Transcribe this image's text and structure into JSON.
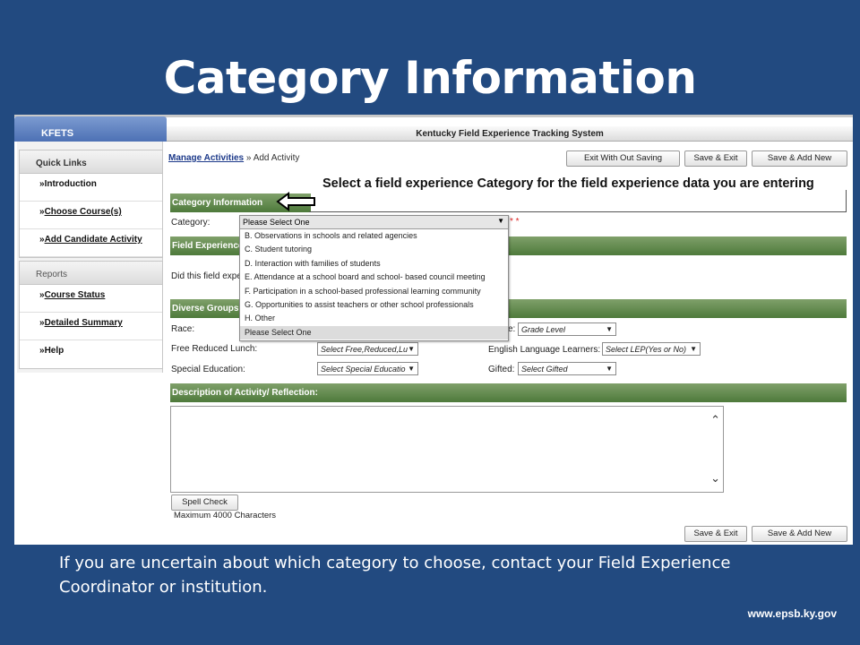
{
  "slide": {
    "title": "Category Information",
    "caption": "If you are uncertain about which category to choose, contact your Field Experience Coordinator or institution.",
    "url": "www.epsb.ky.gov"
  },
  "app": {
    "tab": "KFETS",
    "system_title": "Kentucky Field Experience Tracking System"
  },
  "sidebar": {
    "quick_links_title": "Quick Links",
    "reports_title": "Reports",
    "quick_links": [
      {
        "prefix": "»",
        "label": "Introduction"
      },
      {
        "prefix": "»",
        "label": "Choose Course(s)"
      },
      {
        "prefix": "»",
        "label": "Add Candidate Activity"
      }
    ],
    "reports": [
      {
        "prefix": "»",
        "label": "Course Status"
      },
      {
        "prefix": "»",
        "label": "Detailed Summary"
      },
      {
        "prefix": "»",
        "label": "Help"
      }
    ]
  },
  "breadcrumb": {
    "link": "Manage Activities",
    "separator": " » ",
    "current": "Add Activity"
  },
  "toolbar": {
    "exit_without_saving": "Exit With Out Saving",
    "save_exit": "Save & Exit",
    "save_add_new": "Save & Add New"
  },
  "headline": "Select a field experience Category for the field experience data you are entering",
  "sections": {
    "category": "Category Information",
    "field_experience": "Field Experience",
    "diverse_groups": "Diverse Groups",
    "description": "Description of Activity/ Reflection:"
  },
  "form": {
    "category_label": "Category:",
    "category_value": "Please Select One",
    "required_marker": "* *",
    "field_question": "Did this field expe",
    "race_label": "Race:",
    "grade_label": "e:",
    "grade_value": "Grade Level",
    "lunch_label": "Free Reduced Lunch:",
    "lunch_value": "Select Free,Reduced,Lu",
    "ell_label": "English Language Learners:",
    "ell_value": "Select LEP(Yes or No)",
    "sped_label": "Special Education:",
    "sped_value": "Select Special Educatio",
    "gifted_label": "Gifted:",
    "gifted_value": "Select Gifted",
    "spell_check": "Spell Check",
    "max_chars": "Maximum 4000 Characters"
  },
  "dropdown_options": [
    "B. Observations in schools and related agencies",
    "C. Student tutoring",
    "D. Interaction with families of students",
    "E. Attendance at a school board and school- based council meeting",
    "F. Participation in a school-based professional learning community",
    "G. Opportunities to assist teachers or other school professionals",
    "H. Other",
    "Please Select One"
  ],
  "colors": {
    "slide_bg": "#224a80",
    "section_bar": "#5b8448",
    "tab_blue": "#5b7fc0"
  }
}
